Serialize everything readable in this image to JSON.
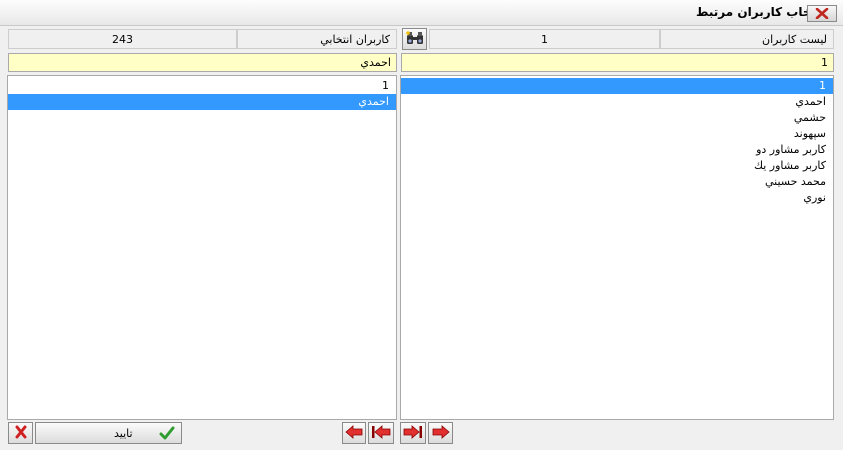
{
  "window": {
    "title": "انتخاب کاربران مرتبط"
  },
  "right_panel": {
    "header_label": "ليست کاربران",
    "header_count": "1",
    "search_value": "1",
    "items": [
      "1",
      "احمدي",
      "حشمي",
      "سپهوند",
      "کاربر مشاور دو",
      "کاربر مشاور يك",
      "محمد حسيني",
      "نوري"
    ],
    "selected_index": 0
  },
  "left_panel": {
    "header_label": "کاربران انتخابي",
    "header_count": "243",
    "search_value": "احمدي",
    "items": [
      "1",
      "احمدي"
    ],
    "selected_index": 1
  },
  "buttons": {
    "confirm_label": "تاييد"
  },
  "icons": {
    "search": "binoculars-icon",
    "close": "close-icon",
    "cancel": "red-x-icon",
    "confirm": "green-check-icon"
  },
  "colors": {
    "selection": "#3399ff",
    "search_bg": "#ffffc6",
    "arrow": "#e03030"
  }
}
